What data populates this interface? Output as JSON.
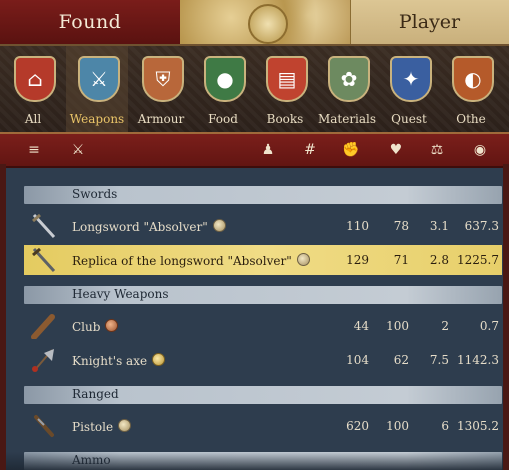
{
  "header": {
    "found_label": "Found",
    "player_label": "Player"
  },
  "categories": [
    {
      "label": "All",
      "icon": "all-items-icon",
      "color": "#b53a2a",
      "glyph": "⌂"
    },
    {
      "label": "Weapons",
      "icon": "weapons-icon",
      "color": "#4d86a8",
      "glyph": "⚔",
      "selected": true
    },
    {
      "label": "Armour",
      "icon": "armour-icon",
      "color": "#b8673a",
      "glyph": "⛨"
    },
    {
      "label": "Food",
      "icon": "food-icon",
      "color": "#3f7a45",
      "glyph": "●"
    },
    {
      "label": "Books",
      "icon": "books-icon",
      "color": "#c0432f",
      "glyph": "▤"
    },
    {
      "label": "Materials",
      "icon": "materials-icon",
      "color": "#6d8a60",
      "glyph": "✿"
    },
    {
      "label": "Quest",
      "icon": "quest-icon",
      "color": "#3a5fa0",
      "glyph": "✦"
    },
    {
      "label": "Othe",
      "icon": "other-icon",
      "color": "#b55a2a",
      "glyph": "◐"
    }
  ],
  "filters": [
    {
      "name": "sort-icon",
      "glyph": "≡"
    },
    {
      "name": "filter-type-icon",
      "glyph": "⚔"
    },
    {
      "name": "armour-stat-icon",
      "glyph": "♟"
    },
    {
      "name": "number-stat-icon",
      "glyph": "#"
    },
    {
      "name": "strength-stat-icon",
      "glyph": "✊"
    },
    {
      "name": "condition-stat-icon",
      "glyph": "♥"
    },
    {
      "name": "weight-stat-icon",
      "glyph": "⚖"
    },
    {
      "name": "price-stat-icon",
      "glyph": "◉"
    }
  ],
  "sections": [
    {
      "title": "Swords",
      "items": [
        {
          "name": "Longsword \"Absolver\"",
          "coin": "silver",
          "icon": "longsword-icon",
          "v1": "110",
          "v2": "78",
          "v3": "3.1",
          "v4": "637.3"
        },
        {
          "name": "Replica of the longsword \"Absolver\"",
          "coin": "silver",
          "icon": "longsword-replica-icon",
          "v1": "129",
          "v2": "71",
          "v3": "2.8",
          "v4": "1225.7",
          "highlight": true
        }
      ]
    },
    {
      "title": "Heavy Weapons",
      "items": [
        {
          "name": "Club",
          "coin": "copper",
          "icon": "club-icon",
          "v1": "44",
          "v2": "100",
          "v3": "2",
          "v4": "0.7"
        },
        {
          "name": "Knight's axe",
          "coin": "gold",
          "icon": "axe-icon",
          "v1": "104",
          "v2": "62",
          "v3": "7.5",
          "v4": "1142.3"
        }
      ]
    },
    {
      "title": "Ranged",
      "items": [
        {
          "name": "Pistole",
          "coin": "silver",
          "icon": "pistole-icon",
          "v1": "620",
          "v2": "100",
          "v3": "6",
          "v4": "1305.2"
        }
      ]
    },
    {
      "title": "Ammo",
      "items": []
    }
  ]
}
